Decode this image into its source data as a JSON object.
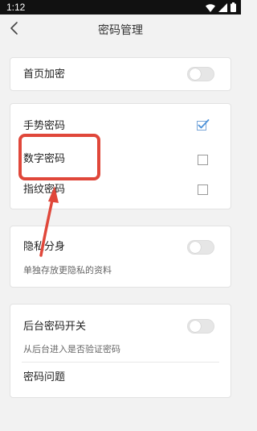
{
  "status_bar": {
    "time": "1:12"
  },
  "header": {
    "title": "密码管理",
    "back_icon": "chevron-left-icon"
  },
  "sections": {
    "homepage_lock": {
      "label": "首页加密",
      "enabled": false
    },
    "password_types": {
      "gesture": {
        "label": "手势密码",
        "checked": true
      },
      "numeric": {
        "label": "数字密码",
        "checked": false
      },
      "fingerprint": {
        "label": "指纹密码",
        "checked": false
      }
    },
    "private_clone": {
      "label": "隐私分身",
      "description": "单独存放更隐私的资料",
      "enabled": false
    },
    "background_lock": {
      "label": "后台密码开关",
      "description": "从后台进入是否验证密码",
      "enabled": false
    },
    "security_question": {
      "label": "密码问题"
    }
  },
  "colors": {
    "annotation": "#e0473a",
    "check_accent": "#4a90d9",
    "toggle_off": "#e6e6e6",
    "background": "#f2f2f2"
  }
}
